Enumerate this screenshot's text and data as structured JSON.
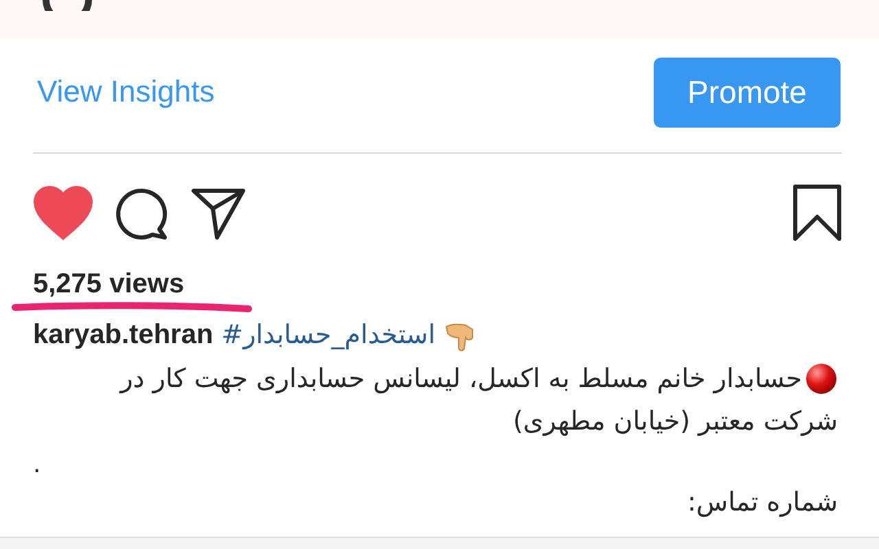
{
  "insights_link": "View Insights",
  "promote_button": "Promote",
  "actions": {
    "liked": true,
    "saved": false
  },
  "views": "5,275 views",
  "caption": {
    "username": "karyab.tehran",
    "hashtag": "#استخدام_حسابدار",
    "lines": [
      "حسابدار خانم مسلط به اکسل، لیسانس حسابداری جهت کار در",
      "شرکت معتبر (خیابان مطهری)"
    ],
    "dot": ".",
    "contact": "شماره تماس:"
  }
}
